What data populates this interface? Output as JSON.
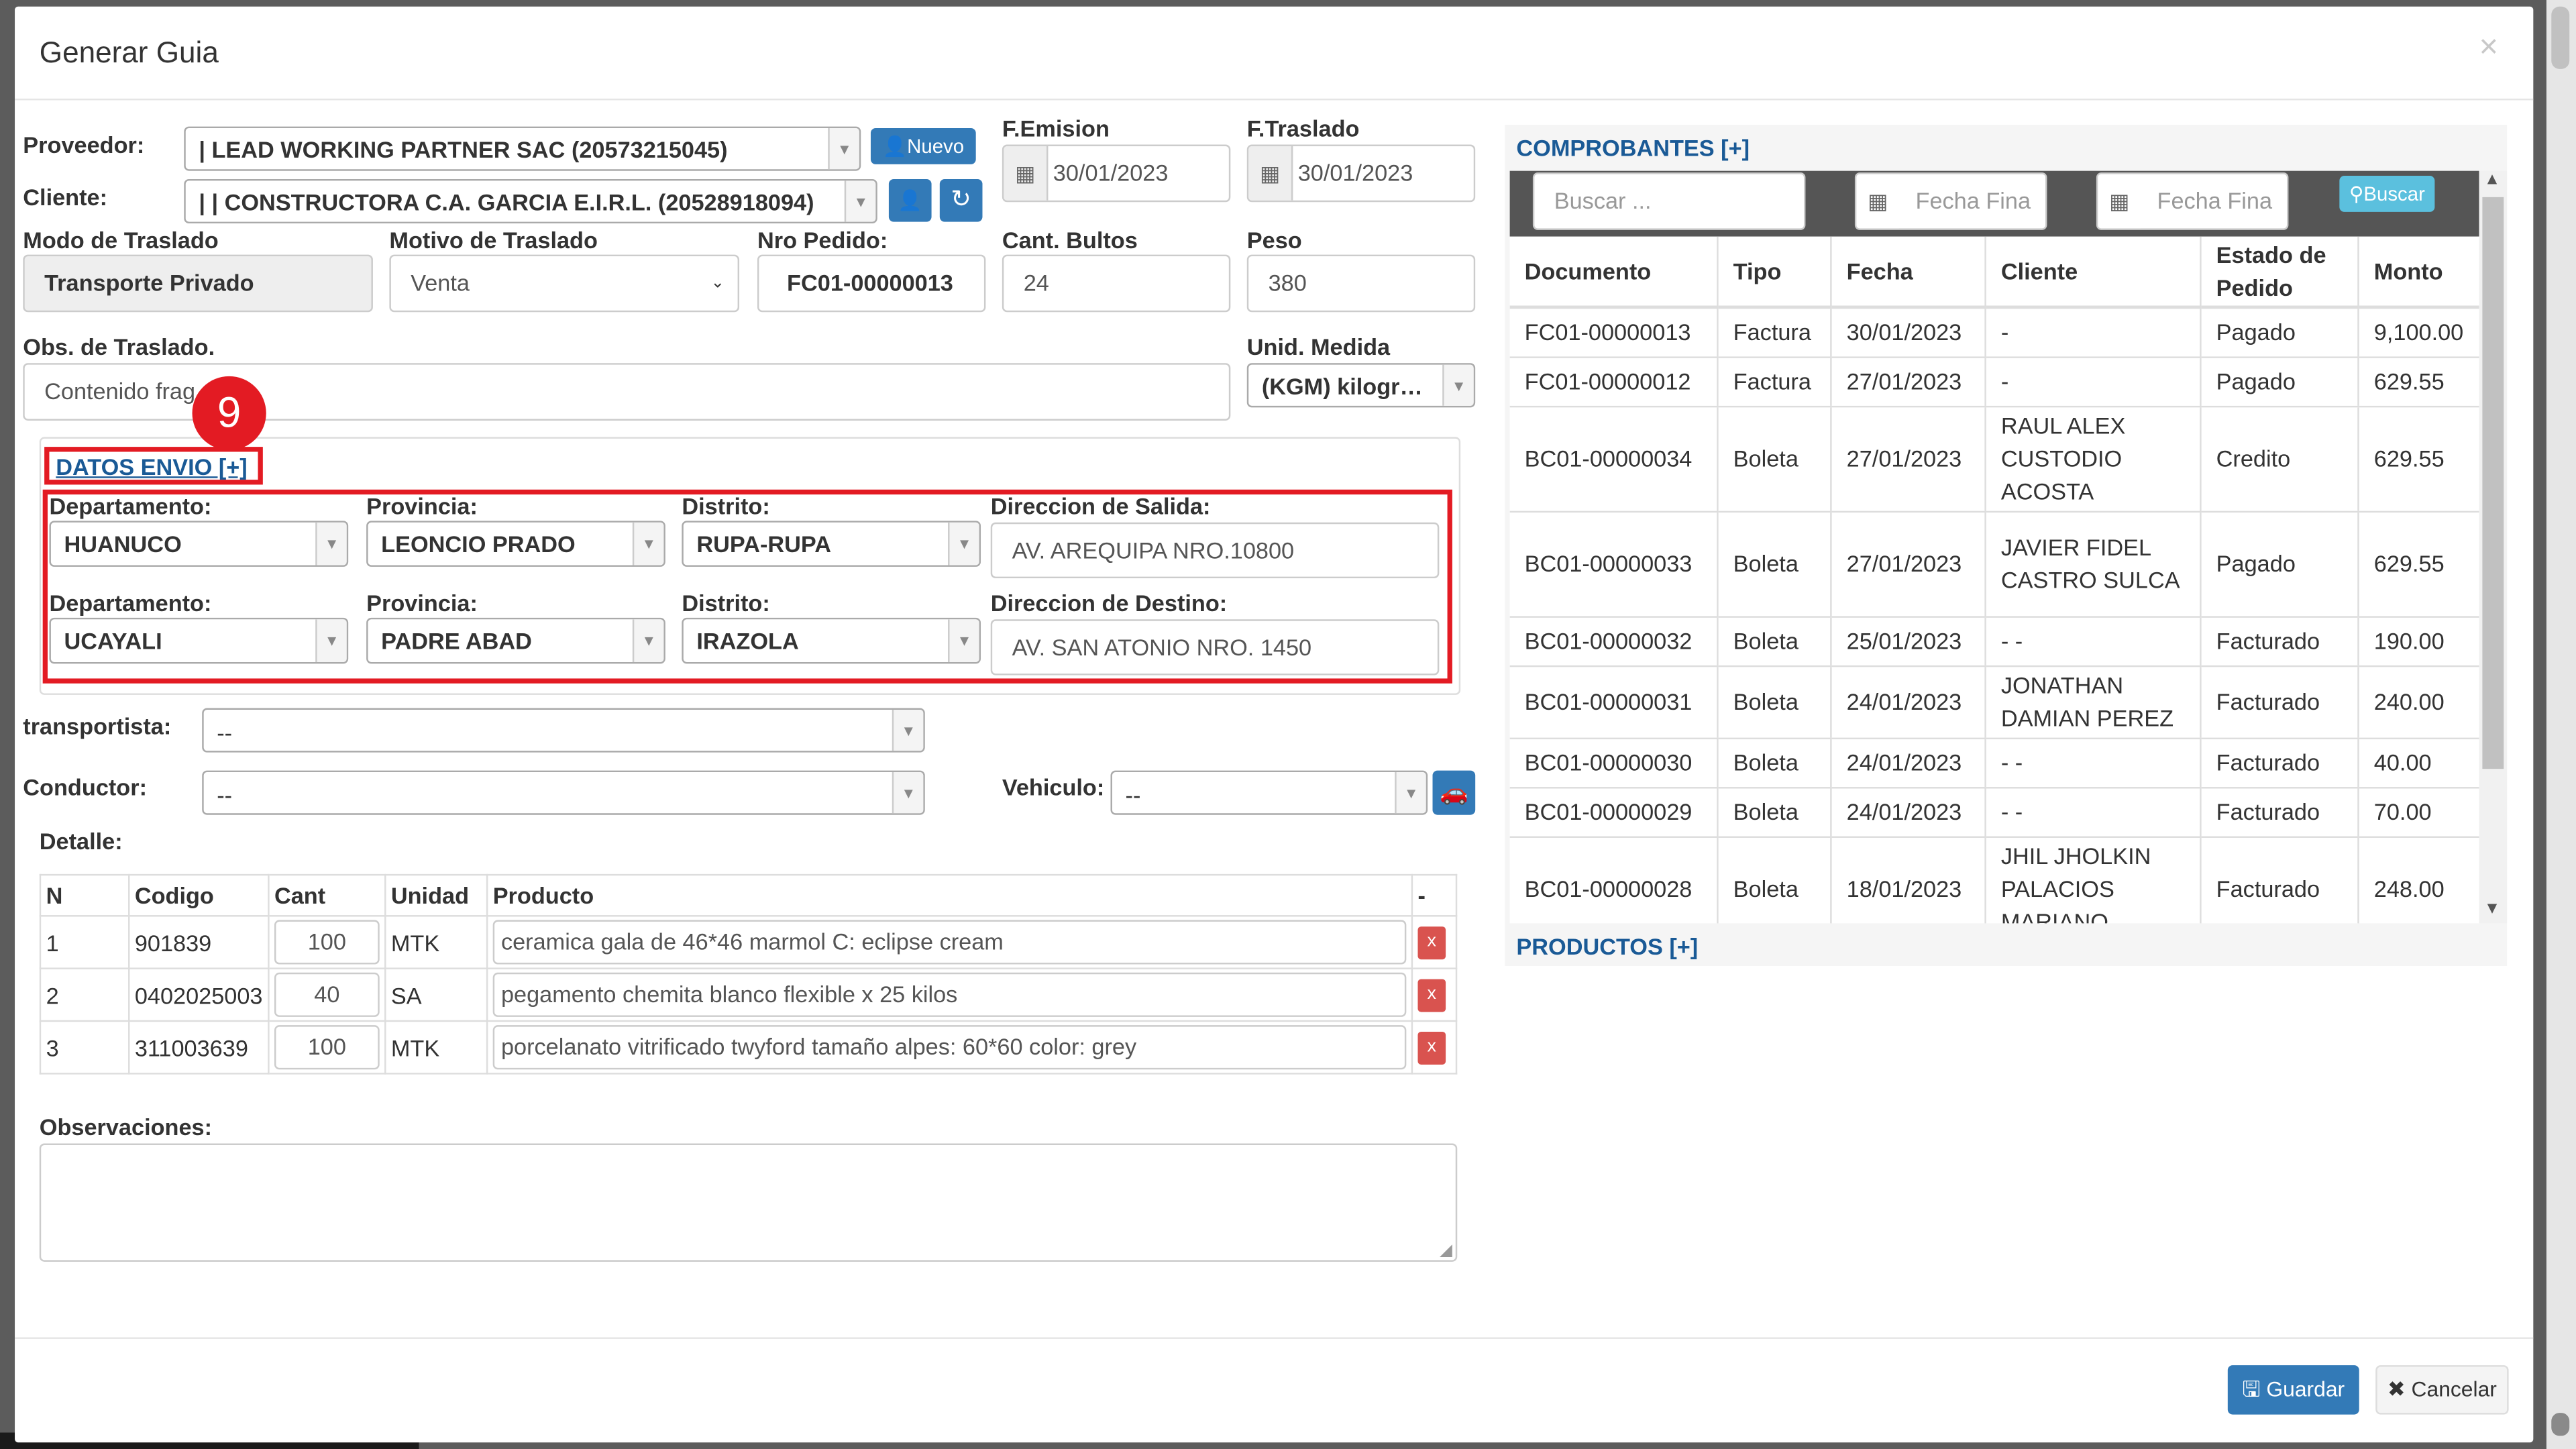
{
  "modal": {
    "title": "Generar Guia",
    "close_glyph": "×"
  },
  "form": {
    "proveedor_label": "Proveedor:",
    "proveedor_value": "| LEAD WORKING PARTNER SAC (20573215045)",
    "nuevo_label": "Nuevo",
    "cliente_label": "Cliente:",
    "cliente_value": "| | CONSTRUCTORA C.A. GARCIA E.I.R.L. (20528918094)",
    "femision_label": "F.Emision",
    "femision_value": "30/01/2023",
    "ftraslado_label": "F.Traslado",
    "ftraslado_value": "30/01/2023",
    "modo_label": "Modo de Traslado",
    "modo_value": "Transporte Privado",
    "motivo_label": "Motivo de Traslado",
    "motivo_value": "Venta",
    "pedido_label": "Nro Pedido:",
    "pedido_value": "FC01-00000013",
    "bultos_label": "Cant. Bultos",
    "bultos_value": "24",
    "peso_label": "Peso",
    "peso_value": "380",
    "obs_label": "Obs. de Traslado.",
    "obs_value": "Contenido frag",
    "unidad_label": "Unid. Medida",
    "unidad_value": "(KGM) kilogr…",
    "step_badge": "9",
    "datos_envio_label": "DATOS ENVIO [+]",
    "salida": {
      "dep_label": "Departamento:",
      "dep_value": "HUANUCO",
      "prov_label": "Provincia:",
      "prov_value": "LEONCIO PRADO",
      "dist_label": "Distrito:",
      "dist_value": "RUPA-RUPA",
      "dir_label": "Direccion de Salida:",
      "dir_value": "AV. AREQUIPA NRO.10800"
    },
    "destino": {
      "dep_label": "Departamento:",
      "dep_value": "UCAYALI",
      "prov_label": "Provincia:",
      "prov_value": "PADRE ABAD",
      "dist_label": "Distrito:",
      "dist_value": "IRAZOLA",
      "dir_label": "Direccion de Destino:",
      "dir_value": "AV. SAN ATONIO NRO. 1450"
    },
    "transportista_label": "transportista:",
    "transportista_value": "--",
    "conductor_label": "Conductor:",
    "conductor_value": "--",
    "vehiculo_label": "Vehiculo:",
    "vehiculo_value": "--",
    "detalle_label": "Detalle:",
    "observaciones_label": "Observaciones:"
  },
  "detalle": {
    "headers": {
      "n": "N",
      "codigo": "Codigo",
      "cant": "Cant",
      "unidad": "Unidad",
      "producto": "Producto",
      "del": "-"
    },
    "rows": [
      {
        "n": "1",
        "codigo": "901839",
        "cant": "100",
        "unidad": "MTK",
        "producto": "ceramica gala de 46*46 marmol C: eclipse cream",
        "del": "x"
      },
      {
        "n": "2",
        "codigo": "0402025003",
        "cant": "40",
        "unidad": "SA",
        "producto": "pegamento chemita blanco flexible x 25 kilos",
        "del": "x"
      },
      {
        "n": "3",
        "codigo": "311003639",
        "cant": "100",
        "unidad": "MTK",
        "producto": "porcelanato vitrificado twyford tamaño alpes: 60*60 color: grey",
        "del": "x"
      }
    ]
  },
  "comprobantes": {
    "title": "COMPROBANTES [+]",
    "search_placeholder": "Buscar ...",
    "fecha_ini_placeholder": "Fecha Fina",
    "fecha_fin_placeholder": "Fecha Fina",
    "buscar_label": "Buscar",
    "headers": {
      "doc": "Documento",
      "tipo": "Tipo",
      "fecha": "Fecha",
      "cliente": "Cliente",
      "estado": "Estado de Pedido",
      "monto": "Monto"
    },
    "rows": [
      {
        "doc": "FC01-00000013",
        "tipo": "Factura",
        "fecha": "30/01/2023",
        "cliente": "-",
        "estado": "Pagado",
        "monto": "9,100.00"
      },
      {
        "doc": "FC01-00000012",
        "tipo": "Factura",
        "fecha": "27/01/2023",
        "cliente": "-",
        "estado": "Pagado",
        "monto": "629.55"
      },
      {
        "doc": "BC01-00000034",
        "tipo": "Boleta",
        "fecha": "27/01/2023",
        "cliente": "RAUL ALEX CUSTODIO ACOSTA",
        "estado": "Credito",
        "monto": "629.55"
      },
      {
        "doc": "BC01-00000033",
        "tipo": "Boleta",
        "fecha": "27/01/2023",
        "cliente": "JAVIER FIDEL CASTRO SULCA",
        "estado": "Pagado",
        "monto": "629.55"
      },
      {
        "doc": "BC01-00000032",
        "tipo": "Boleta",
        "fecha": "25/01/2023",
        "cliente": "- -",
        "estado": "Facturado",
        "monto": "190.00"
      },
      {
        "doc": "BC01-00000031",
        "tipo": "Boleta",
        "fecha": "24/01/2023",
        "cliente": "JONATHAN DAMIAN PEREZ",
        "estado": "Facturado",
        "monto": "240.00"
      },
      {
        "doc": "BC01-00000030",
        "tipo": "Boleta",
        "fecha": "24/01/2023",
        "cliente": "- -",
        "estado": "Facturado",
        "monto": "40.00"
      },
      {
        "doc": "BC01-00000029",
        "tipo": "Boleta",
        "fecha": "24/01/2023",
        "cliente": "- -",
        "estado": "Facturado",
        "monto": "70.00"
      },
      {
        "doc": "BC01-00000028",
        "tipo": "Boleta",
        "fecha": "18/01/2023",
        "cliente": "JHIL JHOLKIN PALACIOS MARIANO",
        "estado": "Facturado",
        "monto": "248.00"
      }
    ]
  },
  "productos": {
    "title": "PRODUCTOS [+]"
  },
  "footer": {
    "guardar_label": "Guardar",
    "cancelar_label": "Cancelar"
  },
  "colors": {
    "primary": "#337ab7",
    "danger": "#d9534f",
    "info": "#5bc0de",
    "highlight": "#e31b23",
    "link": "#1a5a96"
  }
}
